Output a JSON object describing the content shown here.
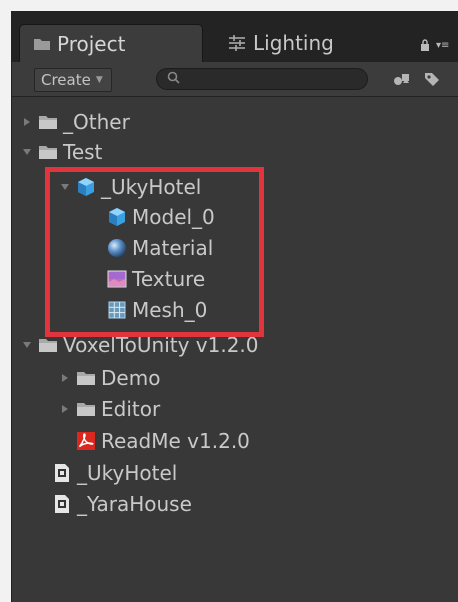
{
  "tabs": {
    "project": {
      "label": "Project",
      "icon": "folder-icon"
    },
    "lighting": {
      "label": "Lighting",
      "icon": "sliders-icon"
    }
  },
  "toolbar": {
    "create_label": "Create",
    "search_placeholder": ""
  },
  "tree": {
    "other": "_Other",
    "test": "Test",
    "uky_hotel_folder": "_UkyHotel",
    "model": "Model_0",
    "material": "Material",
    "texture": "Texture",
    "mesh": "Mesh_0",
    "voxel": "VoxelToUnity v1.2.0",
    "demo": "Demo",
    "editor": "Editor",
    "readme": "ReadMe v1.2.0",
    "uky_hotel_file": "_UkyHotel",
    "yara_house": "_YaraHouse"
  },
  "colors": {
    "highlight": "#e0353c",
    "panel": "#383838",
    "text": "#c9c9c9"
  }
}
